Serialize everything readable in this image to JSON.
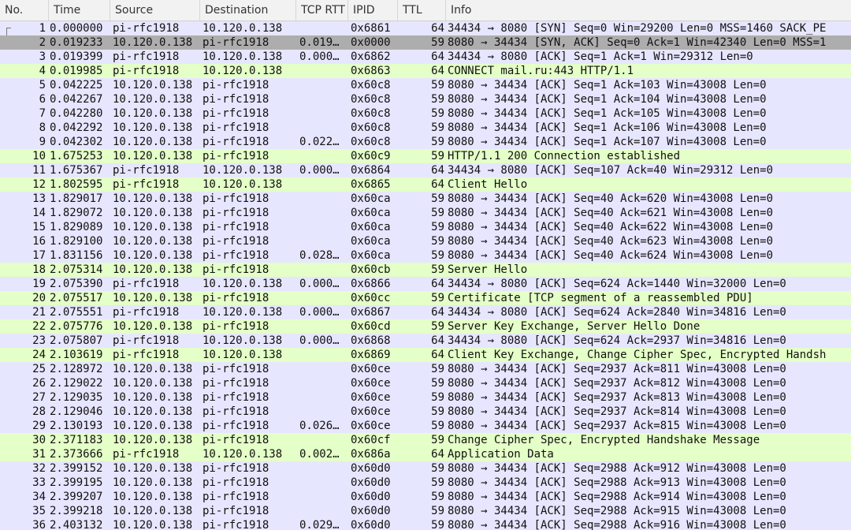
{
  "columns": {
    "no": "No.",
    "time": "Time",
    "source": "Source",
    "destination": "Destination",
    "tcp_rtt": "TCP RTT",
    "ipid": "IPID",
    "ttl": "TTL",
    "info": "Info"
  },
  "colors": {
    "tcp": "#e7e6ff",
    "http": "#e4ffc7",
    "selected": "#adadad"
  },
  "selected_row": 2,
  "packets": [
    {
      "no": "1",
      "time": "0.000000",
      "src": "pi-rfc1918",
      "dst": "10.120.0.138",
      "rtt": "",
      "ipid": "0x6861",
      "ttl": "64",
      "info": "34434 → 8080 [SYN] Seq=0 Win=29200 Len=0 MSS=1460 SACK_PE",
      "type": "tcp"
    },
    {
      "no": "2",
      "time": "0.019233",
      "src": "10.120.0.138",
      "dst": "pi-rfc1918",
      "rtt": "0.019…",
      "ipid": "0x0000",
      "ttl": "59",
      "info": "8080 → 34434 [SYN, ACK] Seq=0 Ack=1 Win=42340 Len=0 MSS=1",
      "type": "selected"
    },
    {
      "no": "3",
      "time": "0.019399",
      "src": "pi-rfc1918",
      "dst": "10.120.0.138",
      "rtt": "0.000…",
      "ipid": "0x6862",
      "ttl": "64",
      "info": "34434 → 8080 [ACK] Seq=1 Ack=1 Win=29312 Len=0",
      "type": "tcp"
    },
    {
      "no": "4",
      "time": "0.019985",
      "src": "pi-rfc1918",
      "dst": "10.120.0.138",
      "rtt": "",
      "ipid": "0x6863",
      "ttl": "64",
      "info": "CONNECT mail.ru:443 HTTP/1.1",
      "type": "http"
    },
    {
      "no": "5",
      "time": "0.042225",
      "src": "10.120.0.138",
      "dst": "pi-rfc1918",
      "rtt": "",
      "ipid": "0x60c8",
      "ttl": "59",
      "info": "8080 → 34434 [ACK] Seq=1 Ack=103 Win=43008 Len=0",
      "type": "tcp"
    },
    {
      "no": "6",
      "time": "0.042267",
      "src": "10.120.0.138",
      "dst": "pi-rfc1918",
      "rtt": "",
      "ipid": "0x60c8",
      "ttl": "59",
      "info": "8080 → 34434 [ACK] Seq=1 Ack=104 Win=43008 Len=0",
      "type": "tcp"
    },
    {
      "no": "7",
      "time": "0.042280",
      "src": "10.120.0.138",
      "dst": "pi-rfc1918",
      "rtt": "",
      "ipid": "0x60c8",
      "ttl": "59",
      "info": "8080 → 34434 [ACK] Seq=1 Ack=105 Win=43008 Len=0",
      "type": "tcp"
    },
    {
      "no": "8",
      "time": "0.042292",
      "src": "10.120.0.138",
      "dst": "pi-rfc1918",
      "rtt": "",
      "ipid": "0x60c8",
      "ttl": "59",
      "info": "8080 → 34434 [ACK] Seq=1 Ack=106 Win=43008 Len=0",
      "type": "tcp"
    },
    {
      "no": "9",
      "time": "0.042302",
      "src": "10.120.0.138",
      "dst": "pi-rfc1918",
      "rtt": "0.022…",
      "ipid": "0x60c8",
      "ttl": "59",
      "info": "8080 → 34434 [ACK] Seq=1 Ack=107 Win=43008 Len=0",
      "type": "tcp"
    },
    {
      "no": "10",
      "time": "1.675253",
      "src": "10.120.0.138",
      "dst": "pi-rfc1918",
      "rtt": "",
      "ipid": "0x60c9",
      "ttl": "59",
      "info": "HTTP/1.1 200 Connection established",
      "type": "http"
    },
    {
      "no": "11",
      "time": "1.675367",
      "src": "pi-rfc1918",
      "dst": "10.120.0.138",
      "rtt": "0.000…",
      "ipid": "0x6864",
      "ttl": "64",
      "info": "34434 → 8080 [ACK] Seq=107 Ack=40 Win=29312 Len=0",
      "type": "tcp"
    },
    {
      "no": "12",
      "time": "1.802595",
      "src": "pi-rfc1918",
      "dst": "10.120.0.138",
      "rtt": "",
      "ipid": "0x6865",
      "ttl": "64",
      "info": "Client Hello",
      "type": "http"
    },
    {
      "no": "13",
      "time": "1.829017",
      "src": "10.120.0.138",
      "dst": "pi-rfc1918",
      "rtt": "",
      "ipid": "0x60ca",
      "ttl": "59",
      "info": "8080 → 34434 [ACK] Seq=40 Ack=620 Win=43008 Len=0",
      "type": "tcp"
    },
    {
      "no": "14",
      "time": "1.829072",
      "src": "10.120.0.138",
      "dst": "pi-rfc1918",
      "rtt": "",
      "ipid": "0x60ca",
      "ttl": "59",
      "info": "8080 → 34434 [ACK] Seq=40 Ack=621 Win=43008 Len=0",
      "type": "tcp"
    },
    {
      "no": "15",
      "time": "1.829089",
      "src": "10.120.0.138",
      "dst": "pi-rfc1918",
      "rtt": "",
      "ipid": "0x60ca",
      "ttl": "59",
      "info": "8080 → 34434 [ACK] Seq=40 Ack=622 Win=43008 Len=0",
      "type": "tcp"
    },
    {
      "no": "16",
      "time": "1.829100",
      "src": "10.120.0.138",
      "dst": "pi-rfc1918",
      "rtt": "",
      "ipid": "0x60ca",
      "ttl": "59",
      "info": "8080 → 34434 [ACK] Seq=40 Ack=623 Win=43008 Len=0",
      "type": "tcp"
    },
    {
      "no": "17",
      "time": "1.831156",
      "src": "10.120.0.138",
      "dst": "pi-rfc1918",
      "rtt": "0.028…",
      "ipid": "0x60ca",
      "ttl": "59",
      "info": "8080 → 34434 [ACK] Seq=40 Ack=624 Win=43008 Len=0",
      "type": "tcp"
    },
    {
      "no": "18",
      "time": "2.075314",
      "src": "10.120.0.138",
      "dst": "pi-rfc1918",
      "rtt": "",
      "ipid": "0x60cb",
      "ttl": "59",
      "info": "Server Hello",
      "type": "http"
    },
    {
      "no": "19",
      "time": "2.075390",
      "src": "pi-rfc1918",
      "dst": "10.120.0.138",
      "rtt": "0.000…",
      "ipid": "0x6866",
      "ttl": "64",
      "info": "34434 → 8080 [ACK] Seq=624 Ack=1440 Win=32000 Len=0",
      "type": "tcp"
    },
    {
      "no": "20",
      "time": "2.075517",
      "src": "10.120.0.138",
      "dst": "pi-rfc1918",
      "rtt": "",
      "ipid": "0x60cc",
      "ttl": "59",
      "info": "Certificate [TCP segment of a reassembled PDU]",
      "type": "http"
    },
    {
      "no": "21",
      "time": "2.075551",
      "src": "pi-rfc1918",
      "dst": "10.120.0.138",
      "rtt": "0.000…",
      "ipid": "0x6867",
      "ttl": "64",
      "info": "34434 → 8080 [ACK] Seq=624 Ack=2840 Win=34816 Len=0",
      "type": "tcp"
    },
    {
      "no": "22",
      "time": "2.075776",
      "src": "10.120.0.138",
      "dst": "pi-rfc1918",
      "rtt": "",
      "ipid": "0x60cd",
      "ttl": "59",
      "info": "Server Key Exchange, Server Hello Done",
      "type": "http"
    },
    {
      "no": "23",
      "time": "2.075807",
      "src": "pi-rfc1918",
      "dst": "10.120.0.138",
      "rtt": "0.000…",
      "ipid": "0x6868",
      "ttl": "64",
      "info": "34434 → 8080 [ACK] Seq=624 Ack=2937 Win=34816 Len=0",
      "type": "tcp"
    },
    {
      "no": "24",
      "time": "2.103619",
      "src": "pi-rfc1918",
      "dst": "10.120.0.138",
      "rtt": "",
      "ipid": "0x6869",
      "ttl": "64",
      "info": "Client Key Exchange, Change Cipher Spec, Encrypted Handsh",
      "type": "http"
    },
    {
      "no": "25",
      "time": "2.128972",
      "src": "10.120.0.138",
      "dst": "pi-rfc1918",
      "rtt": "",
      "ipid": "0x60ce",
      "ttl": "59",
      "info": "8080 → 34434 [ACK] Seq=2937 Ack=811 Win=43008 Len=0",
      "type": "tcp"
    },
    {
      "no": "26",
      "time": "2.129022",
      "src": "10.120.0.138",
      "dst": "pi-rfc1918",
      "rtt": "",
      "ipid": "0x60ce",
      "ttl": "59",
      "info": "8080 → 34434 [ACK] Seq=2937 Ack=812 Win=43008 Len=0",
      "type": "tcp"
    },
    {
      "no": "27",
      "time": "2.129035",
      "src": "10.120.0.138",
      "dst": "pi-rfc1918",
      "rtt": "",
      "ipid": "0x60ce",
      "ttl": "59",
      "info": "8080 → 34434 [ACK] Seq=2937 Ack=813 Win=43008 Len=0",
      "type": "tcp"
    },
    {
      "no": "28",
      "time": "2.129046",
      "src": "10.120.0.138",
      "dst": "pi-rfc1918",
      "rtt": "",
      "ipid": "0x60ce",
      "ttl": "59",
      "info": "8080 → 34434 [ACK] Seq=2937 Ack=814 Win=43008 Len=0",
      "type": "tcp"
    },
    {
      "no": "29",
      "time": "2.130193",
      "src": "10.120.0.138",
      "dst": "pi-rfc1918",
      "rtt": "0.026…",
      "ipid": "0x60ce",
      "ttl": "59",
      "info": "8080 → 34434 [ACK] Seq=2937 Ack=815 Win=43008 Len=0",
      "type": "tcp"
    },
    {
      "no": "30",
      "time": "2.371183",
      "src": "10.120.0.138",
      "dst": "pi-rfc1918",
      "rtt": "",
      "ipid": "0x60cf",
      "ttl": "59",
      "info": "Change Cipher Spec, Encrypted Handshake Message",
      "type": "http"
    },
    {
      "no": "31",
      "time": "2.373666",
      "src": "pi-rfc1918",
      "dst": "10.120.0.138",
      "rtt": "0.002…",
      "ipid": "0x686a",
      "ttl": "64",
      "info": "Application Data",
      "type": "http"
    },
    {
      "no": "32",
      "time": "2.399152",
      "src": "10.120.0.138",
      "dst": "pi-rfc1918",
      "rtt": "",
      "ipid": "0x60d0",
      "ttl": "59",
      "info": "8080 → 34434 [ACK] Seq=2988 Ack=912 Win=43008 Len=0",
      "type": "tcp"
    },
    {
      "no": "33",
      "time": "2.399195",
      "src": "10.120.0.138",
      "dst": "pi-rfc1918",
      "rtt": "",
      "ipid": "0x60d0",
      "ttl": "59",
      "info": "8080 → 34434 [ACK] Seq=2988 Ack=913 Win=43008 Len=0",
      "type": "tcp"
    },
    {
      "no": "34",
      "time": "2.399207",
      "src": "10.120.0.138",
      "dst": "pi-rfc1918",
      "rtt": "",
      "ipid": "0x60d0",
      "ttl": "59",
      "info": "8080 → 34434 [ACK] Seq=2988 Ack=914 Win=43008 Len=0",
      "type": "tcp"
    },
    {
      "no": "35",
      "time": "2.399218",
      "src": "10.120.0.138",
      "dst": "pi-rfc1918",
      "rtt": "",
      "ipid": "0x60d0",
      "ttl": "59",
      "info": "8080 → 34434 [ACK] Seq=2988 Ack=915 Win=43008 Len=0",
      "type": "tcp"
    },
    {
      "no": "36",
      "time": "2.403132",
      "src": "10.120.0.138",
      "dst": "pi-rfc1918",
      "rtt": "0.029…",
      "ipid": "0x60d0",
      "ttl": "59",
      "info": "8080 → 34434 [ACK] Seq=2988 Ack=916 Win=43008 Len=0",
      "type": "tcp"
    }
  ]
}
